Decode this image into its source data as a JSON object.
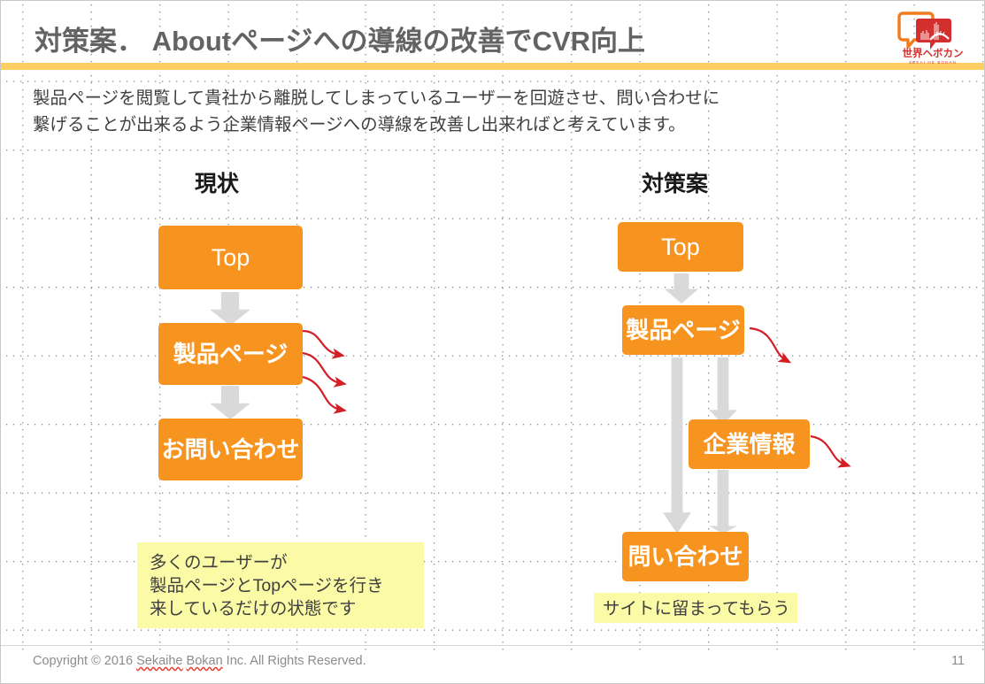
{
  "slide": {
    "title": "対策案． Aboutページへの導線の改善でCVR向上",
    "lead_line1": "製品ページを閲覧して貴社から離脱してしまっているユーザーを回遊させ、問い合わせに",
    "lead_line2": "繋げることが出来るよう企業情報ページへの導線を改善し出来ればと考えています。",
    "accent_rule_color": "#ffce63",
    "box_color": "#f7941f",
    "arrow_grey": "#d9d9d9",
    "arrow_red": "#d31f26",
    "note_yellow": "#fbfaa6"
  },
  "logo": {
    "name": "sekai-he-bokan-logo",
    "wordmark": "世界ヘボカン",
    "romaji": "SEKAI HE BOKAN",
    "bubble_outline_color": "#f07c1e",
    "bubble_fill_color": "#d42f2f"
  },
  "columns": {
    "current": {
      "heading": "現状",
      "boxes": [
        {
          "label": "Top",
          "script": "latin"
        },
        {
          "label": "製品ページ",
          "script": "jp"
        },
        {
          "label": "お問い合わせ",
          "script": "jp"
        }
      ],
      "note": [
        "多くのユーザーが",
        "製品ページとTopページを行き",
        "来しているだけの状態です"
      ],
      "exit_arrow_count": 3
    },
    "proposal": {
      "heading": "対策案",
      "boxes": [
        {
          "label": "Top",
          "script": "latin"
        },
        {
          "label": "製品ページ",
          "script": "jp"
        },
        {
          "label": "企業情報",
          "script": "jp"
        },
        {
          "label": "問い合わせ",
          "script": "jp"
        }
      ],
      "note": [
        "サイトに留まってもらう"
      ],
      "exit_arrow_count": 2
    }
  },
  "footer": {
    "copyright_prefix": "Copyright © 2016 ",
    "copyright_brand_a": "Sekaihe",
    "copyright_space": " ",
    "copyright_brand_b": "Bokan",
    "copyright_suffix": " Inc. All Rights Reserved.",
    "page_number": "11"
  }
}
